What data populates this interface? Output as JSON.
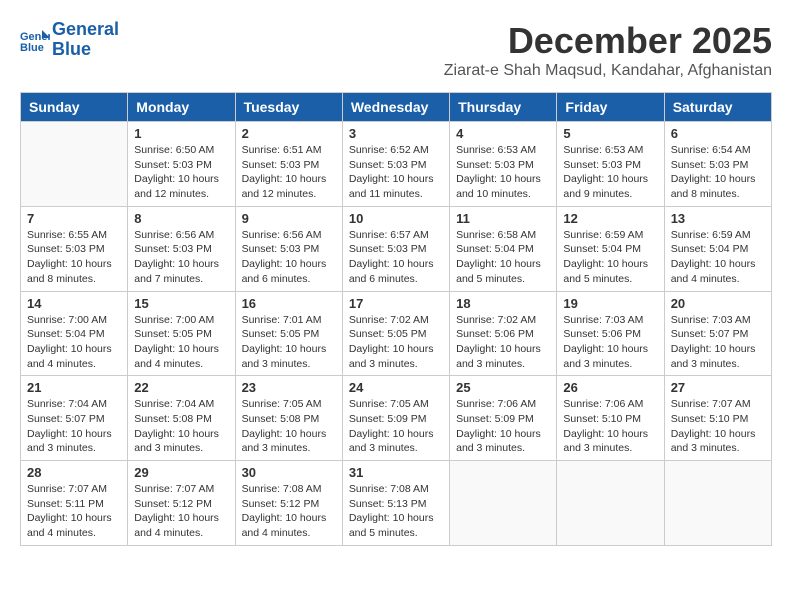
{
  "header": {
    "logo_line1": "General",
    "logo_line2": "Blue",
    "month_title": "December 2025",
    "subtitle": "Ziarat-e Shah Maqsud, Kandahar, Afghanistan"
  },
  "weekdays": [
    "Sunday",
    "Monday",
    "Tuesday",
    "Wednesday",
    "Thursday",
    "Friday",
    "Saturday"
  ],
  "weeks": [
    [
      {
        "day": "",
        "info": ""
      },
      {
        "day": "1",
        "info": "Sunrise: 6:50 AM\nSunset: 5:03 PM\nDaylight: 10 hours\nand 12 minutes."
      },
      {
        "day": "2",
        "info": "Sunrise: 6:51 AM\nSunset: 5:03 PM\nDaylight: 10 hours\nand 12 minutes."
      },
      {
        "day": "3",
        "info": "Sunrise: 6:52 AM\nSunset: 5:03 PM\nDaylight: 10 hours\nand 11 minutes."
      },
      {
        "day": "4",
        "info": "Sunrise: 6:53 AM\nSunset: 5:03 PM\nDaylight: 10 hours\nand 10 minutes."
      },
      {
        "day": "5",
        "info": "Sunrise: 6:53 AM\nSunset: 5:03 PM\nDaylight: 10 hours\nand 9 minutes."
      },
      {
        "day": "6",
        "info": "Sunrise: 6:54 AM\nSunset: 5:03 PM\nDaylight: 10 hours\nand 8 minutes."
      }
    ],
    [
      {
        "day": "7",
        "info": "Sunrise: 6:55 AM\nSunset: 5:03 PM\nDaylight: 10 hours\nand 8 minutes."
      },
      {
        "day": "8",
        "info": "Sunrise: 6:56 AM\nSunset: 5:03 PM\nDaylight: 10 hours\nand 7 minutes."
      },
      {
        "day": "9",
        "info": "Sunrise: 6:56 AM\nSunset: 5:03 PM\nDaylight: 10 hours\nand 6 minutes."
      },
      {
        "day": "10",
        "info": "Sunrise: 6:57 AM\nSunset: 5:03 PM\nDaylight: 10 hours\nand 6 minutes."
      },
      {
        "day": "11",
        "info": "Sunrise: 6:58 AM\nSunset: 5:04 PM\nDaylight: 10 hours\nand 5 minutes."
      },
      {
        "day": "12",
        "info": "Sunrise: 6:59 AM\nSunset: 5:04 PM\nDaylight: 10 hours\nand 5 minutes."
      },
      {
        "day": "13",
        "info": "Sunrise: 6:59 AM\nSunset: 5:04 PM\nDaylight: 10 hours\nand 4 minutes."
      }
    ],
    [
      {
        "day": "14",
        "info": "Sunrise: 7:00 AM\nSunset: 5:04 PM\nDaylight: 10 hours\nand 4 minutes."
      },
      {
        "day": "15",
        "info": "Sunrise: 7:00 AM\nSunset: 5:05 PM\nDaylight: 10 hours\nand 4 minutes."
      },
      {
        "day": "16",
        "info": "Sunrise: 7:01 AM\nSunset: 5:05 PM\nDaylight: 10 hours\nand 3 minutes."
      },
      {
        "day": "17",
        "info": "Sunrise: 7:02 AM\nSunset: 5:05 PM\nDaylight: 10 hours\nand 3 minutes."
      },
      {
        "day": "18",
        "info": "Sunrise: 7:02 AM\nSunset: 5:06 PM\nDaylight: 10 hours\nand 3 minutes."
      },
      {
        "day": "19",
        "info": "Sunrise: 7:03 AM\nSunset: 5:06 PM\nDaylight: 10 hours\nand 3 minutes."
      },
      {
        "day": "20",
        "info": "Sunrise: 7:03 AM\nSunset: 5:07 PM\nDaylight: 10 hours\nand 3 minutes."
      }
    ],
    [
      {
        "day": "21",
        "info": "Sunrise: 7:04 AM\nSunset: 5:07 PM\nDaylight: 10 hours\nand 3 minutes."
      },
      {
        "day": "22",
        "info": "Sunrise: 7:04 AM\nSunset: 5:08 PM\nDaylight: 10 hours\nand 3 minutes."
      },
      {
        "day": "23",
        "info": "Sunrise: 7:05 AM\nSunset: 5:08 PM\nDaylight: 10 hours\nand 3 minutes."
      },
      {
        "day": "24",
        "info": "Sunrise: 7:05 AM\nSunset: 5:09 PM\nDaylight: 10 hours\nand 3 minutes."
      },
      {
        "day": "25",
        "info": "Sunrise: 7:06 AM\nSunset: 5:09 PM\nDaylight: 10 hours\nand 3 minutes."
      },
      {
        "day": "26",
        "info": "Sunrise: 7:06 AM\nSunset: 5:10 PM\nDaylight: 10 hours\nand 3 minutes."
      },
      {
        "day": "27",
        "info": "Sunrise: 7:07 AM\nSunset: 5:10 PM\nDaylight: 10 hours\nand 3 minutes."
      }
    ],
    [
      {
        "day": "28",
        "info": "Sunrise: 7:07 AM\nSunset: 5:11 PM\nDaylight: 10 hours\nand 4 minutes."
      },
      {
        "day": "29",
        "info": "Sunrise: 7:07 AM\nSunset: 5:12 PM\nDaylight: 10 hours\nand 4 minutes."
      },
      {
        "day": "30",
        "info": "Sunrise: 7:08 AM\nSunset: 5:12 PM\nDaylight: 10 hours\nand 4 minutes."
      },
      {
        "day": "31",
        "info": "Sunrise: 7:08 AM\nSunset: 5:13 PM\nDaylight: 10 hours\nand 5 minutes."
      },
      {
        "day": "",
        "info": ""
      },
      {
        "day": "",
        "info": ""
      },
      {
        "day": "",
        "info": ""
      }
    ]
  ]
}
